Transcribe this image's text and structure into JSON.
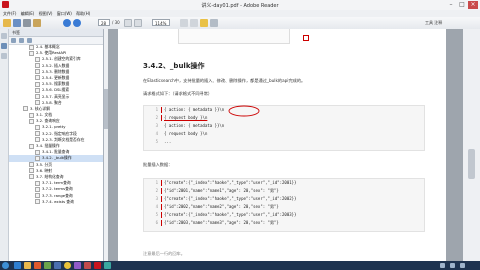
{
  "window": {
    "title": "讲义-day01.pdf - Adobe Reader"
  },
  "menu": [
    "文件(F)",
    "编辑(E)",
    "视图(V)",
    "窗口(W)",
    "帮助(H)"
  ],
  "toolbar": {
    "page_current": "28",
    "page_total": "/ 30",
    "zoom": "114%",
    "right_label": "工具  注释"
  },
  "bookmarks": {
    "header": "书签",
    "items": [
      "2.4. 基本概念",
      "2.5. 使用RestAPI",
      "2.5.1. 创建空的索引库",
      "2.5.2. 插入数据",
      "2.5.3. 删除数据",
      "2.5.4. 更新数据",
      "2.5.5. 搜索数据",
      "2.5.6. DSL搜索",
      "2.5.7. 高亮显示",
      "2.5.8. 聚合",
      "3. 核心详解",
      "3.1. 文档",
      "3.2. 查询响应",
      "3.2.1. pretty",
      "3.2.2. 指定响应字段",
      "3.2.3. 判断文档是否存在",
      "3.4. 批量操作",
      "3.4.1. 批量查询",
      "3.4.2. _bulk操作",
      "3.5. 分页",
      "3.6. 映射",
      "3.7. 结构化查询",
      "3.7.1. term查询",
      "3.7.2. terms查询",
      "3.7.3. range查询",
      "3.7.4. exists 查询"
    ]
  },
  "page": {
    "heading": "3.4.2、_bulk操作",
    "intro": "在Elasticsearch中，支持批量的插入、修改、删除操作，都是通过_bulk的api完成的。",
    "format_label": "请求格式如下：（请求格式不同寻常）",
    "format_code": [
      "{ action: { metadata }}\\n",
      "{ request body        }\\n",
      "{ action: { metadata }}\\n",
      "{ request body        }\\n",
      "..."
    ],
    "batch_label": "批量插入数据：",
    "batch_code": [
      "{\"create\":{\"_index\":\"haoke\",\"_type\":\"user\",\"_id\":2001}}",
      "{\"id\":2001,\"name\":\"name1\",\"age\": 20,\"sex\": \"男\"}",
      "{\"create\":{\"_index\":\"haoke\",\"_type\":\"user\",\"_id\":2002}}",
      "{\"id\":2002,\"name\":\"name2\",\"age\": 20,\"sex\": \"男\"}",
      "{\"create\":{\"_index\":\"haoke\",\"_type\":\"user\",\"_id\":2003}}",
      "{\"id\":2003,\"name\":\"name3\",\"age\": 20,\"sex\": \"男\"}"
    ],
    "footer_hint": "注意最后一行的回车。"
  },
  "colors": {
    "taskbar": "#1e3350",
    "accent_red": "#cc0000"
  }
}
